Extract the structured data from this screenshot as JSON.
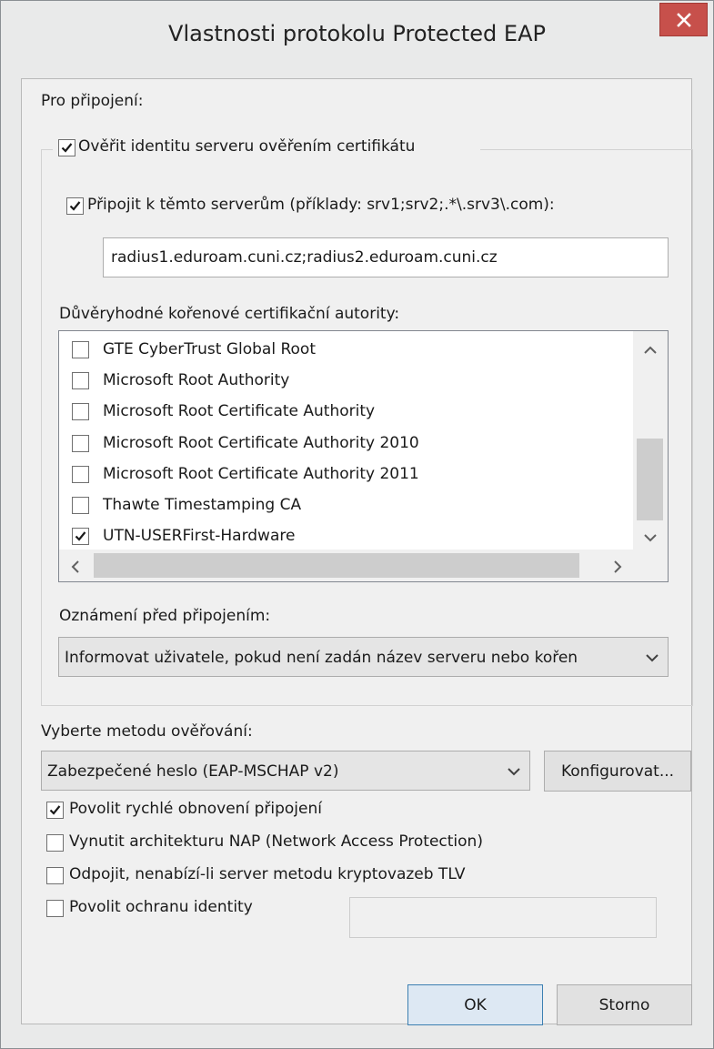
{
  "window": {
    "title": "Vlastnosti protokolu Protected EAP"
  },
  "connect_label": "Pro připojení:",
  "verify_cert": {
    "label": "Ověřit identitu serveru ověřením certifikátu",
    "checked": true
  },
  "connect_servers": {
    "label": "Připojit k těmto serverům (příklady: srv1;srv2;.*\\.srv3\\.com):",
    "checked": true,
    "value": "radius1.eduroam.cuni.cz;radius2.eduroam.cuni.cz"
  },
  "trusted_ca": {
    "label": "Důvěryhodné kořenové certifikační autority:",
    "items": [
      {
        "label": "GTE CyberTrust Global Root",
        "checked": false
      },
      {
        "label": "Microsoft Root Authority",
        "checked": false
      },
      {
        "label": "Microsoft Root Certificate Authority",
        "checked": false
      },
      {
        "label": "Microsoft Root Certificate Authority 2010",
        "checked": false
      },
      {
        "label": "Microsoft Root Certificate Authority 2011",
        "checked": false
      },
      {
        "label": "Thawte Timestamping CA",
        "checked": false
      },
      {
        "label": "UTN-USERFirst-Hardware",
        "checked": true
      }
    ]
  },
  "notification": {
    "label": "Oznámení před připojením:",
    "value": "Informovat uživatele, pokud není zadán název serveru nebo kořen"
  },
  "auth_method": {
    "label": "Vyberte metodu ověřování:",
    "value": "Zabezpečené heslo (EAP-MSCHAP v2)",
    "configure_label": "Konfigurovat..."
  },
  "options": [
    {
      "label": "Povolit rychlé obnovení připojení",
      "checked": true
    },
    {
      "label": "Vynutit architekturu NAP (Network Access Protection)",
      "checked": false
    },
    {
      "label": "Odpojit, nenabízí-li server metodu kryptovazeb TLV",
      "checked": false
    },
    {
      "label": "Povolit ochranu identity",
      "checked": false
    }
  ],
  "buttons": {
    "ok": "OK",
    "cancel": "Storno"
  }
}
